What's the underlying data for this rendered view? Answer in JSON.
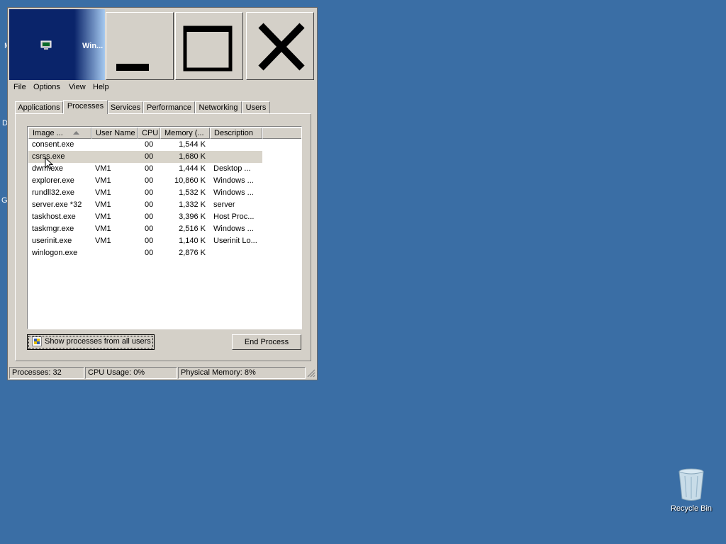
{
  "desktop": {
    "cut_labels": [
      "M",
      "D",
      "G"
    ],
    "recycle_bin_label": "Recycle Bin"
  },
  "window": {
    "title": "Win...",
    "menu": [
      "File",
      "Options",
      "View",
      "Help"
    ],
    "tabs": [
      "Applications",
      "Processes",
      "Services",
      "Performance",
      "Networking",
      "Users"
    ],
    "active_tab": "Processes"
  },
  "table": {
    "columns": [
      "Image ...",
      "User Name",
      "CPU",
      "Memory (...",
      "Description"
    ],
    "sort_column": "Image ...",
    "rows": [
      {
        "image": "consent.exe",
        "user": "",
        "cpu": "00",
        "memory": "1,544 K",
        "description": ""
      },
      {
        "image": "csrss.exe",
        "user": "",
        "cpu": "00",
        "memory": "1,680 K",
        "description": ""
      },
      {
        "image": "dwm.exe",
        "user": "VM1",
        "cpu": "00",
        "memory": "1,444 K",
        "description": "Desktop ..."
      },
      {
        "image": "explorer.exe",
        "user": "VM1",
        "cpu": "00",
        "memory": "10,860 K",
        "description": "Windows ..."
      },
      {
        "image": "rundll32.exe",
        "user": "VM1",
        "cpu": "00",
        "memory": "1,532 K",
        "description": "Windows ..."
      },
      {
        "image": "server.exe *32",
        "user": "VM1",
        "cpu": "00",
        "memory": "1,332 K",
        "description": "server"
      },
      {
        "image": "taskhost.exe",
        "user": "VM1",
        "cpu": "00",
        "memory": "3,396 K",
        "description": "Host Proc..."
      },
      {
        "image": "taskmgr.exe",
        "user": "VM1",
        "cpu": "00",
        "memory": "2,516 K",
        "description": "Windows ..."
      },
      {
        "image": "userinit.exe",
        "user": "VM1",
        "cpu": "00",
        "memory": "1,140 K",
        "description": "Userinit Lo..."
      },
      {
        "image": "winlogon.exe",
        "user": "",
        "cpu": "00",
        "memory": "2,876 K",
        "description": ""
      }
    ],
    "selected_row": 1
  },
  "buttons": {
    "show_all": "Show processes from all users",
    "end_process": "End Process"
  },
  "status": {
    "processes": "Processes: 32",
    "cpu": "CPU Usage: 0%",
    "memory": "Physical Memory: 8%"
  },
  "colors": {
    "desktop": "#3a6ea5",
    "titlebar": "#0a246a",
    "window": "#d4d0c8"
  }
}
